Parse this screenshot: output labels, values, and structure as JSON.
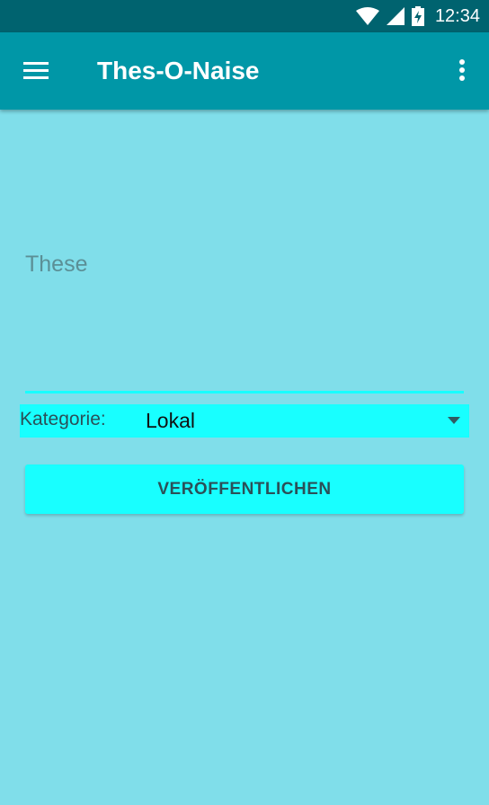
{
  "status_bar": {
    "time": "12:34",
    "icons": [
      "wifi-icon",
      "cell-signal-icon",
      "battery-charging-icon"
    ]
  },
  "app_bar": {
    "title": "Thes-O-Naise",
    "icons": [
      "menu-icon",
      "more-vert-icon"
    ]
  },
  "form": {
    "thesis_placeholder": "These",
    "thesis_value": "",
    "category_label": "Kategorie:",
    "category_selected": "Lokal",
    "publish_label": "VERÖFFENTLICHEN"
  },
  "colors": {
    "background": "#80deea",
    "status_bar": "#00636f",
    "app_bar": "#0097a7",
    "accent": "#18ffff"
  }
}
